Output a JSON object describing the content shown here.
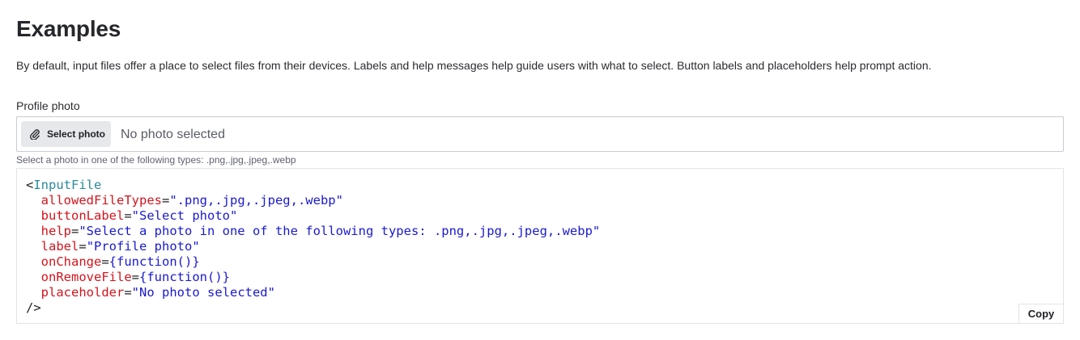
{
  "section": {
    "title": "Examples",
    "description": "By default, input files offer a place to select files from their devices. Labels and help messages help guide users with what to select. Button labels and placeholders help prompt action."
  },
  "file_input": {
    "label": "Profile photo",
    "button_label": "Select photo",
    "button_icon": "paperclip-icon",
    "placeholder": "No photo selected",
    "help": "Select a photo in one of the following types: .png,.jpg,.jpeg,.webp"
  },
  "code": {
    "open": "<",
    "component": "InputFile",
    "close": "/>",
    "props": [
      {
        "name": "allowedFileTypes",
        "eq": "=",
        "value": "\".png,.jpg,.jpeg,.webp\""
      },
      {
        "name": "buttonLabel",
        "eq": "=",
        "value": "\"Select photo\""
      },
      {
        "name": "help",
        "eq": "=",
        "value": "\"Select a photo in one of the following types: .png,.jpg,.jpeg,.webp\""
      },
      {
        "name": "label",
        "eq": "=",
        "value": "\"Profile photo\""
      },
      {
        "name": "onChange",
        "eq": "=",
        "value": "{function()}"
      },
      {
        "name": "onRemoveFile",
        "eq": "=",
        "value": "{function()}"
      },
      {
        "name": "placeholder",
        "eq": "=",
        "value": "\"No photo selected\""
      }
    ],
    "copy_label": "Copy"
  },
  "colors": {
    "tag": "#2a8a9a",
    "attribute": "#d4141c",
    "string": "#1a1ad0"
  }
}
